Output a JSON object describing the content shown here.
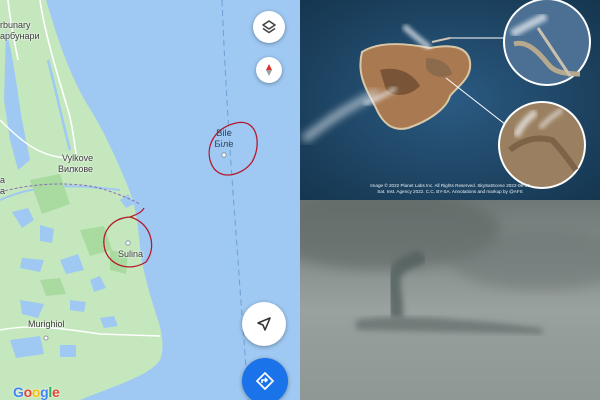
{
  "map": {
    "labels": {
      "carbunary_latin": "rbunary",
      "carbunary_cyrillic": "арбунари",
      "vylkove_latin": "Vylkove",
      "vylkove_cyrillic": "Вилкове",
      "edge_letter_1": "a",
      "edge_letter_2": "а",
      "sulina": "Sulina",
      "murighiol": "Murighiol",
      "bile_latin": "Bile",
      "bile_cyrillic": "Біле"
    },
    "google_logo": [
      "G",
      "o",
      "o",
      "g",
      "l",
      "e"
    ],
    "logo_colors": [
      "#4285F4",
      "#EA4335",
      "#FBBC05",
      "#4285F4",
      "#34A853",
      "#EA4335"
    ],
    "buttons": {
      "layers_icon": "layers-icon",
      "compass_icon": "compass-icon",
      "location_icon": "navigation-arrow-icon",
      "directions_icon": "directions-icon"
    },
    "colors": {
      "sea": "#9fc9f3",
      "land": "#c4e7bd",
      "circle": "#b5192e",
      "directions": "#1a73e8"
    }
  },
  "satellite": {
    "credit_line1": "Image © 2022 Planet Labs Inc. All Rights Reserved. SkySatScene 2022-06-30",
    "credit_line2": "Sat. Inst. Agency 2022. C.C. BY-SA. Annotations and markup by @AFS"
  }
}
